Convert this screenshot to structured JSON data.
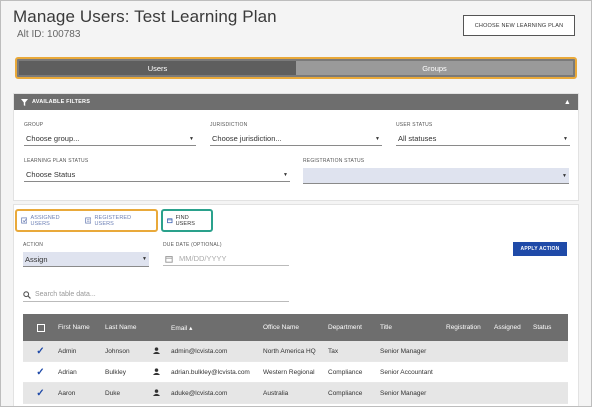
{
  "page": {
    "title": "Manage Users: Test Learning Plan",
    "alt_id": "Alt ID: 100783"
  },
  "header": {
    "choose_button": "CHOOSE NEW LEARNING PLAN"
  },
  "toggle": {
    "users": "Users",
    "groups": "Groups"
  },
  "filters": {
    "title": "AVAILABLE FILTERS",
    "group": {
      "label": "GROUP",
      "value": "Choose group..."
    },
    "jurisdiction": {
      "label": "JURISDICTION",
      "value": "Choose jurisdiction..."
    },
    "user_status": {
      "label": "USER STATUS",
      "value": "All statuses"
    },
    "lp_status": {
      "label": "LEARNING PLAN STATUS",
      "value": "Choose Status"
    },
    "registration_status": {
      "label": "REGISTRATION STATUS",
      "value": ""
    }
  },
  "tabs": {
    "assigned": "ASSIGNED USERS",
    "registered": "REGISTERED USERS",
    "find": "FIND USERS"
  },
  "action": {
    "label": "ACTION",
    "value": "Assign"
  },
  "due_date": {
    "label": "DUE DATE (OPTIONAL)",
    "placeholder": "MM/DD/YYYY"
  },
  "apply_button": "APPLY ACTION",
  "search": {
    "placeholder": "Search table data..."
  },
  "table": {
    "headers": {
      "first": "First Name",
      "last": "Last Name",
      "email": "Email",
      "office": "Office Name",
      "dept": "Department",
      "title": "Title",
      "registration": "Registration",
      "assigned": "Assigned",
      "status": "Status"
    },
    "rows": [
      {
        "first": "Admin",
        "last": "Johnson",
        "email": "admin@lcvista.com",
        "office": "North America HQ",
        "dept": "Tax",
        "title": "Senior Manager"
      },
      {
        "first": "Adrian",
        "last": "Bulkley",
        "email": "adrian.bulkley@lcvista.com",
        "office": "Western Regional",
        "dept": "Compliance",
        "title": "Senior Accountant"
      },
      {
        "first": "Aaron",
        "last": "Duke",
        "email": "aduke@lcvista.com",
        "office": "Australia",
        "dept": "Compliance",
        "title": "Senior Manager"
      }
    ]
  },
  "colors": {
    "accent_blue": "#1f4aa8",
    "highlight_orange": "#e9a93a",
    "highlight_teal": "#2aa18c",
    "header_gray": "#6e6e6e"
  },
  "icons": {
    "filter": "funnel-icon",
    "user": "person-icon",
    "search": "search-icon",
    "calendar": "calendar-icon"
  }
}
